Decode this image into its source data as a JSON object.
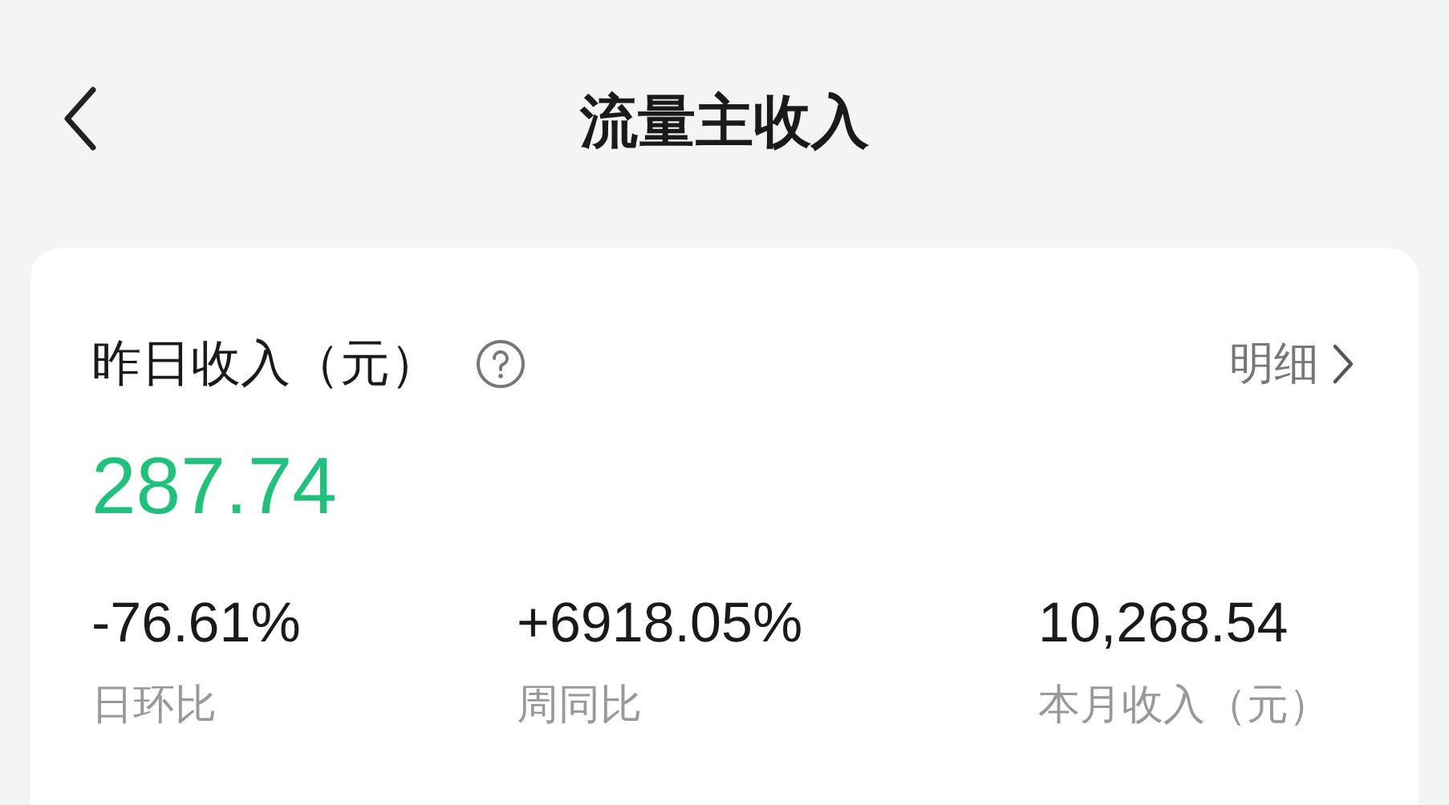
{
  "header": {
    "title": "流量主收入"
  },
  "card": {
    "title": "昨日收入（元）",
    "detail_link": "明细",
    "amount": "287.74",
    "stats": [
      {
        "value": "-76.61%",
        "label": "日环比"
      },
      {
        "value": "+6918.05%",
        "label": "周同比"
      },
      {
        "value": "10,268.54",
        "label": "本月收入（元）"
      }
    ]
  }
}
